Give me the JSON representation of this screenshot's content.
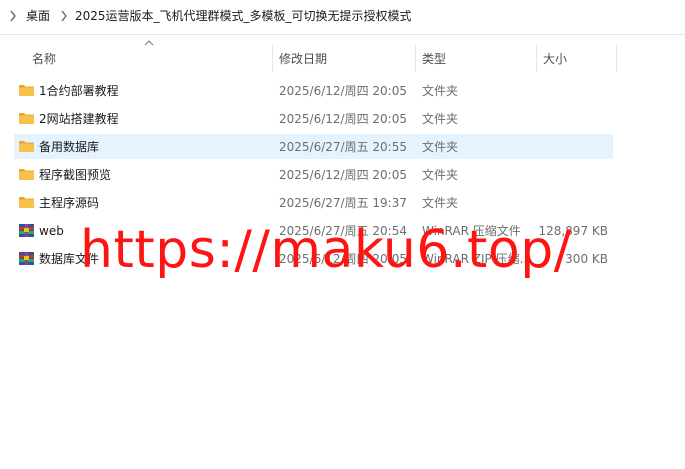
{
  "breadcrumb": {
    "items": [
      "桌面",
      "2025运营版本_飞机代理群模式_多模板_可切换无提示授权模式"
    ]
  },
  "columns": {
    "name": "名称",
    "modified": "修改日期",
    "type": "类型",
    "size": "大小"
  },
  "files": [
    {
      "name": "1合约部署教程",
      "modified": "2025/6/12/周四 20:05",
      "type": "文件夹",
      "size": "",
      "icon": "folder-icon",
      "selected": false
    },
    {
      "name": "2网站搭建教程",
      "modified": "2025/6/12/周四 20:05",
      "type": "文件夹",
      "size": "",
      "icon": "folder-icon",
      "selected": false
    },
    {
      "name": "备用数据库",
      "modified": "2025/6/27/周五 20:55",
      "type": "文件夹",
      "size": "",
      "icon": "folder-icon",
      "selected": true
    },
    {
      "name": "程序截图预览",
      "modified": "2025/6/12/周四 20:05",
      "type": "文件夹",
      "size": "",
      "icon": "folder-icon",
      "selected": false
    },
    {
      "name": "主程序源码",
      "modified": "2025/6/27/周五 19:37",
      "type": "文件夹",
      "size": "",
      "icon": "folder-icon",
      "selected": false
    },
    {
      "name": "web",
      "modified": "2025/6/27/周五 20:54",
      "type": "WinRAR 压缩文件",
      "size": "128,897 KB",
      "icon": "winrar-archive-icon",
      "selected": false
    },
    {
      "name": "数据库文件",
      "modified": "2025/6/12/周四 20:05",
      "type": "WinRAR ZIP 压缩...",
      "size": "300 KB",
      "icon": "winrar-zip-icon",
      "selected": false
    }
  ],
  "watermark": {
    "text": "https://maku6.top/"
  },
  "colors": {
    "selection": "#e5f3ff",
    "folder": "#f8c14a",
    "watermark": "#ff1414"
  }
}
